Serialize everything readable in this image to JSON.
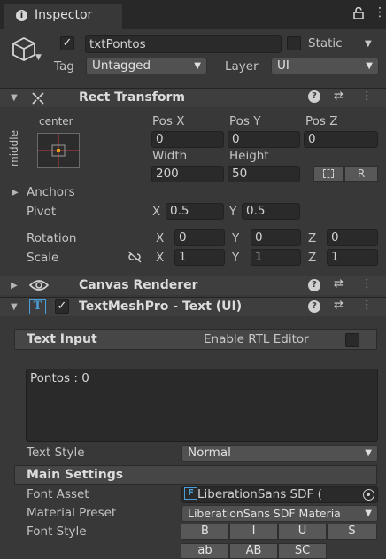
{
  "tab": {
    "title": "Inspector",
    "icon": "info-icon"
  },
  "header": {
    "name": "txtPontos",
    "static_label": "Static",
    "tag_label": "Tag",
    "tag_value": "Untagged",
    "layer_label": "Layer",
    "layer_value": "UI"
  },
  "rect_transform": {
    "title": "Rect Transform",
    "anchor_h": "center",
    "anchor_v": "middle",
    "pos_x_label": "Pos X",
    "pos_y_label": "Pos Y",
    "pos_z_label": "Pos Z",
    "pos_x": "0",
    "pos_y": "0",
    "pos_z": "0",
    "width_label": "Width",
    "height_label": "Height",
    "width": "200",
    "height": "50",
    "r_button": "R",
    "anchors_label": "Anchors",
    "pivot_label": "Pivot",
    "pivot_x_label": "X",
    "pivot_x": "0.5",
    "pivot_y_label": "Y",
    "pivot_y": "0.5",
    "rotation_label": "Rotation",
    "rot_x": "0",
    "rot_y": "0",
    "rot_z": "0",
    "scale_label": "Scale",
    "scale_x": "1",
    "scale_y": "1",
    "scale_z": "1",
    "x_label": "X",
    "y_label": "Y",
    "z_label": "Z"
  },
  "canvas_renderer": {
    "title": "Canvas Renderer"
  },
  "tmp": {
    "title": "TextMeshPro - Text (UI)",
    "text_input_label": "Text Input",
    "rtl_label": "Enable RTL Editor",
    "text_value": "Pontos : 0",
    "text_style_label": "Text Style",
    "text_style_value": "Normal",
    "main_settings_label": "Main Settings",
    "font_asset_label": "Font Asset",
    "font_asset_value": "LiberationSans SDF (",
    "material_preset_label": "Material Preset",
    "material_preset_value": "LiberationSans SDF Materia",
    "font_style_label": "Font Style",
    "style_buttons": [
      "B",
      "I",
      "U",
      "S",
      "ab",
      "AB",
      "SC"
    ]
  },
  "colors": {
    "background": "#383838",
    "field": "#2a2a2a",
    "header": "#3e3e3e",
    "accent": "#4a9fd8"
  }
}
